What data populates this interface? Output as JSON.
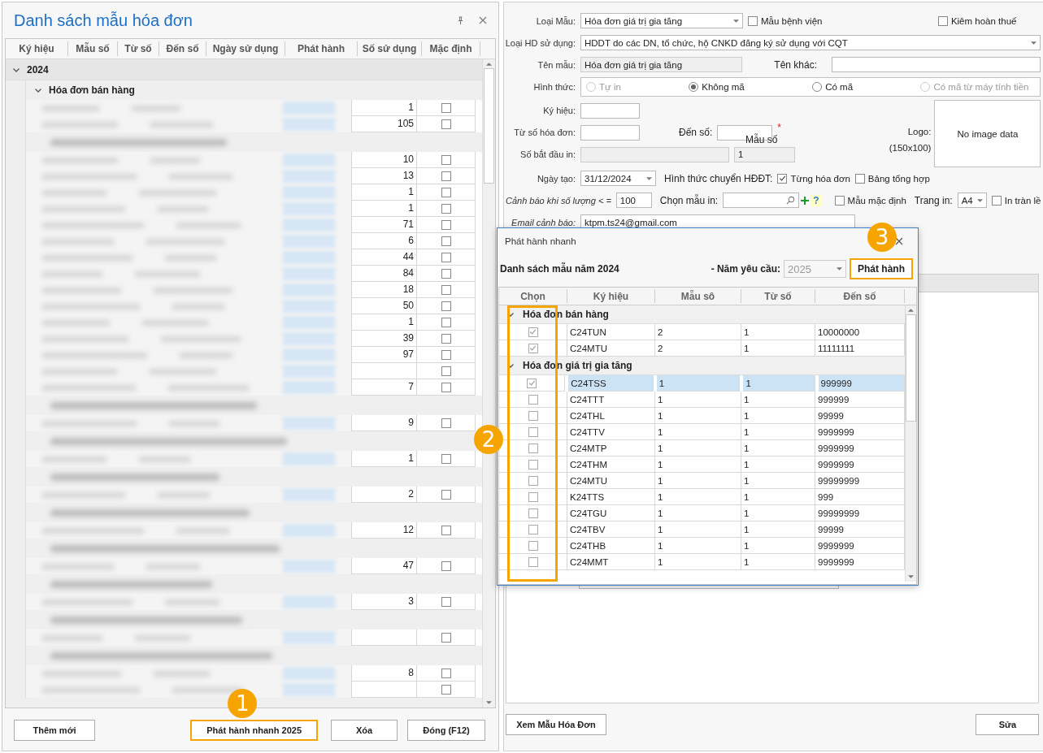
{
  "left_panel": {
    "title": "Danh sách mẫu hóa đơn",
    "columns": [
      "Ký hiệu",
      "Mẫu số",
      "Từ số",
      "Đến số",
      "Ngày sử dụng",
      "Phát hành",
      "Số sử dụng",
      "Mặc định"
    ],
    "year": {
      "label": "2024",
      "expanded": true
    },
    "groups": [
      {
        "label": "Hóa đơn bán hàng",
        "expanded": true,
        "rows": [
          {
            "usage": "1",
            "default": false
          },
          {
            "usage": "105",
            "default": false
          }
        ]
      },
      {
        "rows": [
          {
            "usage": "10",
            "default": false
          },
          {
            "usage": "13",
            "default": false
          },
          {
            "usage": "1",
            "default": false
          },
          {
            "usage": "1",
            "default": false
          },
          {
            "usage": "71",
            "default": false
          },
          {
            "usage": "6",
            "default": false
          },
          {
            "usage": "44",
            "default": false
          },
          {
            "usage": "84",
            "default": false
          },
          {
            "usage": "18",
            "default": false
          },
          {
            "usage": "50",
            "default": false
          },
          {
            "usage": "1",
            "default": false
          },
          {
            "usage": "39",
            "default": false
          },
          {
            "usage": "97",
            "default": false
          },
          {
            "default": false
          },
          {
            "usage": "7",
            "default": false
          }
        ]
      },
      {
        "rows": [
          {
            "usage": "9",
            "default": false
          }
        ]
      },
      {
        "rows": [
          {
            "usage": "1",
            "default": false
          }
        ]
      },
      {
        "rows": [
          {
            "usage": "2",
            "default": false
          }
        ]
      },
      {
        "rows": [
          {
            "usage": "12",
            "default": false
          }
        ]
      },
      {
        "rows": [
          {
            "usage": "47",
            "default": false
          }
        ]
      },
      {
        "rows": [
          {
            "usage": "3",
            "default": false
          }
        ]
      },
      {
        "rows": [
          {
            "default": false
          }
        ]
      },
      {
        "rows": [
          {
            "usage": "8",
            "default": false
          },
          {
            "default": false
          }
        ]
      }
    ],
    "buttons": [
      {
        "label": "Thêm mới",
        "highlighted": false
      },
      {
        "label": "Phát hành nhanh 2025",
        "highlighted": true,
        "callout": "1"
      },
      {
        "label": "Xóa",
        "highlighted": false
      },
      {
        "label": "Đóng (F12)",
        "highlighted": false
      }
    ]
  },
  "form": {
    "template_type": {
      "label": "Loại Mẫu:",
      "value": "Hóa đơn giá trị gia tăng"
    },
    "hospital": {
      "label": "Mẫu bệnh viện",
      "checked": false
    },
    "tax_refund": {
      "label": "Kiêm hoàn thuế",
      "checked": false
    },
    "usage_type": {
      "label": "Loại HD sử dụng:",
      "value": "HDDT do các DN, tổ chức, hộ CNKD đăng ký sử dụng với CQT"
    },
    "template_name": {
      "label": "Tên mẫu:",
      "value": "Hóa đơn giá trị gia tăng",
      "disabled": true
    },
    "other_name": {
      "label": "Tên khác:"
    },
    "form_type": {
      "label": "Hình thức:",
      "options": [
        {
          "label": "Tự in",
          "selected": false,
          "disabled": true
        },
        {
          "label": "Không mã",
          "selected": true,
          "disabled": false
        },
        {
          "label": "Có mã",
          "selected": false,
          "disabled": false
        },
        {
          "label": "Có mã từ máy tính tiền",
          "selected": false,
          "disabled": true
        }
      ]
    },
    "symbol": {
      "label": "Ký hiệu:"
    },
    "from_number": {
      "label": "Từ số hóa đơn:"
    },
    "to_number": {
      "label": "Đến số:",
      "required_mark": "*"
    },
    "form_number": {
      "label": "Mẫu số",
      "value": "1",
      "disabled": true
    },
    "start_print": {
      "label": "Số bắt đầu  in:",
      "disabled": true
    },
    "logo": {
      "label": "Logo:",
      "size": "(150x100)",
      "placeholder": "No image data"
    },
    "created": {
      "label": "Ngày tạo:",
      "value": "31/12/2024"
    },
    "transfer": {
      "label": "Hình thức chuyển HĐĐT:",
      "options": [
        {
          "label": "Từng hóa đơn",
          "checked": true
        },
        {
          "label": "Bảng tổng hợp",
          "checked": false
        }
      ]
    },
    "warn_qty": {
      "label": "Cảnh báo khi số lượng < =",
      "value": "100"
    },
    "print_template": {
      "label": "Chọn mẫu in:",
      "help": "?"
    },
    "default_template": {
      "label": "Mẫu mặc định",
      "checked": false
    },
    "page": {
      "label": "Trang in:",
      "value": "A4"
    },
    "borderless": {
      "label": "In tràn lề",
      "checked": false
    },
    "warn_email": {
      "label": "Email cảnh báo:",
      "value": "ktpm.ts24@gmail.com"
    }
  },
  "right_buttons": [
    "Xem Mẫu Hóa Đơn",
    "Sửa"
  ],
  "dialog": {
    "title": "Phát hành nhanh",
    "list_title": "Danh sách mẫu năm 2024",
    "year_label": "- Năm yêu cầu:",
    "year": {
      "value": "2025",
      "disabled": true
    },
    "action": {
      "label": "Phát hành",
      "highlighted": true,
      "callout": "3"
    },
    "columns": [
      {
        "label": "Chọn",
        "highlighted": true,
        "callout": "2"
      },
      {
        "label": "Ký hiệu"
      },
      {
        "label": "Mẫu sô"
      },
      {
        "label": "Từ số"
      },
      {
        "label": "Đến số"
      }
    ],
    "groups": [
      {
        "label": "Hóa đơn bán hàng",
        "expanded": true,
        "rows": [
          {
            "checked": true,
            "selected": false,
            "symbol": "C24TUN",
            "form": "2",
            "from": "1",
            "to": "10000000"
          },
          {
            "checked": true,
            "selected": false,
            "symbol": "C24MTU",
            "form": "2",
            "from": "1",
            "to": "11111111"
          }
        ]
      },
      {
        "label": "Hóa đơn giá trị gia tăng",
        "expanded": true,
        "rows": [
          {
            "checked": true,
            "selected": true,
            "symbol": "C24TSS",
            "form": "1",
            "from": "1",
            "to": "999999"
          },
          {
            "checked": false,
            "selected": false,
            "symbol": "C24TTT",
            "form": "1",
            "from": "1",
            "to": "999999"
          },
          {
            "checked": false,
            "selected": false,
            "symbol": "C24THL",
            "form": "1",
            "from": "1",
            "to": "99999"
          },
          {
            "checked": false,
            "selected": false,
            "symbol": "C24TTV",
            "form": "1",
            "from": "1",
            "to": "9999999"
          },
          {
            "checked": false,
            "selected": false,
            "symbol": "C24MTP",
            "form": "1",
            "from": "1",
            "to": "9999999"
          },
          {
            "checked": false,
            "selected": false,
            "symbol": "C24THM",
            "form": "1",
            "from": "1",
            "to": "9999999"
          },
          {
            "checked": false,
            "selected": false,
            "symbol": "C24MTU",
            "form": "1",
            "from": "1",
            "to": "99999999"
          },
          {
            "checked": false,
            "selected": false,
            "symbol": "K24TTS",
            "form": "1",
            "from": "1",
            "to": "999"
          },
          {
            "checked": false,
            "selected": false,
            "symbol": "C24TGU",
            "form": "1",
            "from": "1",
            "to": "99999999"
          },
          {
            "checked": false,
            "selected": false,
            "symbol": "C24TBV",
            "form": "1",
            "from": "1",
            "to": "99999"
          },
          {
            "checked": false,
            "selected": false,
            "symbol": "C24THB",
            "form": "1",
            "from": "1",
            "to": "9999999"
          },
          {
            "checked": false,
            "selected": false,
            "symbol": "C24MMT",
            "form": "1",
            "from": "1",
            "to": "9999999"
          }
        ]
      }
    ]
  }
}
